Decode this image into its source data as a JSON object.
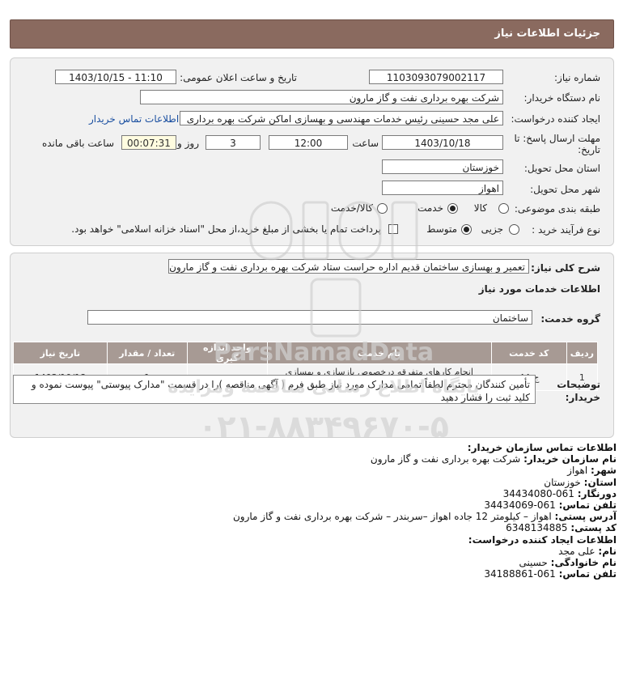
{
  "header": {
    "title": "جزئیات اطلاعات نیاز"
  },
  "form": {
    "need_number_label": "شماره نیاز:",
    "need_number": "1103093079002117",
    "announce_label": "تاریخ و ساعت اعلان عمومی:",
    "announce_value": "1403/10/15 - 11:10",
    "buyer_org_label": "نام دستگاه خریدار:",
    "buyer_org": "شرکت بهره برداری نفت و گاز مارون",
    "creator_label": "ایجاد کننده درخواست:",
    "creator": "علی مجد حسینی رئیس خدمات مهندسی و بهسازی اماکن شرکت بهره برداری",
    "contact_link": "اطلاعات تماس خریدار",
    "deadline_label_1": "مهلت ارسال پاسخ: تا",
    "deadline_label_2": "تاریخ:",
    "deadline_date": "1403/10/18",
    "hour_label": "ساعت",
    "deadline_time": "12:00",
    "days_value": "3",
    "days_label": "روز و",
    "remaining_time": "00:07:31",
    "remaining_label": "ساعت باقی مانده",
    "province_label": "استان محل تحویل:",
    "province": "خوزستان",
    "city_label": "شهر محل تحویل:",
    "city": "اهواز",
    "category_label": "طبقه بندی موضوعی:",
    "category_options": [
      "کالا",
      "خدمت",
      "کالا/خدمت"
    ],
    "category_selected": "خدمت",
    "process_label": "نوع فرآیند خرید :",
    "process_options": [
      "جزیی",
      "متوسط"
    ],
    "process_selected": "متوسط",
    "payment_text": "پرداخت تمام یا بخشی از مبلغ خرید،از محل \"اسناد خزانه اسلامی\" خواهد بود."
  },
  "description": {
    "label": "شرح کلی نیاز:",
    "value": "تعمیر و بهسازی ساختمان قدیم اداره حراست ستاد شرکت بهره برداری نفت و گاز مارون",
    "services_heading": "اطلاعات خدمات مورد نیاز",
    "service_group_label": "گروه خدمت:",
    "service_group": "ساختمان"
  },
  "table": {
    "headers": [
      "ردیف",
      "کد خدمت",
      "نام خدمت",
      "واحد اندازه گیری",
      "تعداد / مقدار",
      "تاریخ نیاز"
    ],
    "rows": [
      [
        "1",
        "ج-44",
        "انجام کارهای متفرقه درخصوص بازسازی و بهسازی ساختمان ها",
        "مورد",
        "1",
        "1403/10/18"
      ]
    ]
  },
  "notes": {
    "label_1": "توضیحات",
    "label_2": "خریدار:",
    "text": "تأمین کنندگان محترم لطفاً تمامی مدارک مورد نیاز طبق فرم ( آگهی مناقصه )را در قسمت \"مدارک پیوستی\" پیوست نموده و کلید ثبت را فشار دهید"
  },
  "contact": {
    "org_heading": "اطلاعات تماس سازمان خریدار:",
    "org_name_label": "نام سازمان خریدار:",
    "org_name": "شرکت بهره برداری نفت و گاز مارون",
    "city_label": "شهر:",
    "city": "اهواز",
    "province_label": "استان:",
    "province": "خوزستان",
    "fax_label": "دورنگار:",
    "fax": "061-34434080",
    "phone_label": "تلفن تماس:",
    "phone": "061-34434069",
    "address_label": "آدرس پستی:",
    "address": "اهواز – کیلومتر 12 جاده اهواز –سربندر – شرکت بهره برداری نفت و گاز مارون",
    "postal_label": "کد پستی:",
    "postal": "6348134885",
    "creator_heading": "اطلاعات ایجاد کننده درخواست:",
    "first_name_label": "نام:",
    "first_name": "علی مجد",
    "last_name_label": "نام خانوادگی:",
    "last_name": "حسینی",
    "creator_phone_label": "تلفن تماس:",
    "creator_phone": "061-34188861"
  },
  "watermark": {
    "line1": "ParsNamadData",
    "line2": "پایگاه اطلاع رسانی مناقصه ومزایده",
    "line3": "۰۲۱-۸۸۳۴۹۶۷۰-۵"
  },
  "colors": {
    "header_bg": "#8a6a5f",
    "table_header_bg": "#a79a94",
    "link": "#1a4fa0"
  }
}
